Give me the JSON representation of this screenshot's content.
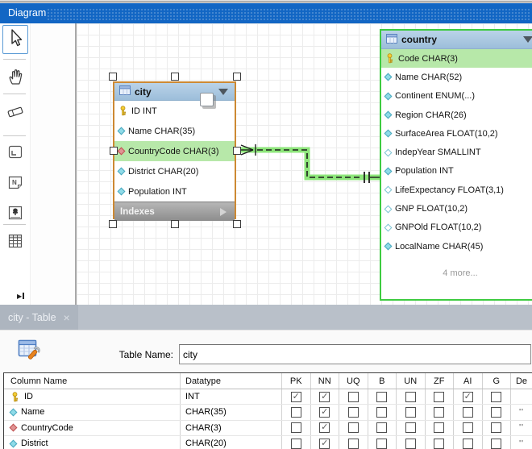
{
  "window": {
    "title": "Diagram"
  },
  "toolbar": {
    "selected_tool": "select",
    "tools": [
      "select",
      "pan",
      "eraser",
      "layer",
      "note",
      "image",
      "table"
    ],
    "expand_glyph": "▶"
  },
  "canvas": {
    "relationship": {
      "from": "city.CountryCode",
      "to": "country",
      "style": "dashed",
      "from_cardinality": "many",
      "to_cardinality": "one"
    },
    "tables": [
      {
        "title": "city",
        "selected": true,
        "footer": "Indexes",
        "columns": [
          {
            "label": "ID INT",
            "icon": "primary-key",
            "highlighted": false
          },
          {
            "label": "Name CHAR(35)",
            "icon": "column",
            "highlighted": false
          },
          {
            "label": "CountryCode CHAR(3)",
            "icon": "foreign-key",
            "highlighted": true
          },
          {
            "label": "District CHAR(20)",
            "icon": "column",
            "highlighted": false
          },
          {
            "label": "Population INT",
            "icon": "column",
            "highlighted": false
          }
        ]
      },
      {
        "title": "country",
        "selected": false,
        "more_label": "4 more...",
        "columns": [
          {
            "label": "Code CHAR(3)",
            "icon": "primary-key",
            "highlighted": true
          },
          {
            "label": "Name CHAR(52)",
            "icon": "column",
            "highlighted": false
          },
          {
            "label": "Continent ENUM(...)",
            "icon": "column",
            "highlighted": false
          },
          {
            "label": "Region CHAR(26)",
            "icon": "column",
            "highlighted": false
          },
          {
            "label": "SurfaceArea FLOAT(10,2)",
            "icon": "column",
            "highlighted": false
          },
          {
            "label": "IndepYear SMALLINT",
            "icon": "column-nullable",
            "highlighted": false
          },
          {
            "label": "Population INT",
            "icon": "column",
            "highlighted": false
          },
          {
            "label": "LifeExpectancy FLOAT(3,1)",
            "icon": "column-nullable",
            "highlighted": false
          },
          {
            "label": "GNP FLOAT(10,2)",
            "icon": "column-nullable",
            "highlighted": false
          },
          {
            "label": "GNPOld FLOAT(10,2)",
            "icon": "column-nullable",
            "highlighted": false
          },
          {
            "label": "LocalName CHAR(45)",
            "icon": "column",
            "highlighted": false
          }
        ]
      }
    ]
  },
  "bottom_panel": {
    "tab": {
      "label": "city - Table",
      "close_glyph": "×"
    },
    "table_name_label": "Table Name:",
    "table_name_value": "city",
    "grid": {
      "headers": [
        "Column Name",
        "Datatype",
        "PK",
        "NN",
        "UQ",
        "B",
        "UN",
        "ZF",
        "AI",
        "G",
        "De"
      ],
      "rows": [
        {
          "icon": "primary-key",
          "name": "ID",
          "datatype": "INT",
          "flags": [
            true,
            true,
            false,
            false,
            false,
            false,
            true,
            false
          ],
          "default": ""
        },
        {
          "icon": "column",
          "name": "Name",
          "datatype": "CHAR(35)",
          "flags": [
            false,
            true,
            false,
            false,
            false,
            false,
            false,
            false
          ],
          "default": "''"
        },
        {
          "icon": "foreign-key",
          "name": "CountryCode",
          "datatype": "CHAR(3)",
          "flags": [
            false,
            true,
            false,
            false,
            false,
            false,
            false,
            false
          ],
          "default": "''"
        },
        {
          "icon": "column",
          "name": "District",
          "datatype": "CHAR(20)",
          "flags": [
            false,
            true,
            false,
            false,
            false,
            false,
            false,
            false
          ],
          "default": "''"
        }
      ]
    }
  },
  "colors": {
    "titlebar_blue": "#1266c4",
    "table_header_blue": "#aecbe3",
    "highlight_green": "#b7e8a9",
    "selection_orange": "#cd8933",
    "relationship_green": "#3ecb41",
    "tabbar_gray": "#b9c0c9",
    "canvas_grid": "#ececec"
  }
}
